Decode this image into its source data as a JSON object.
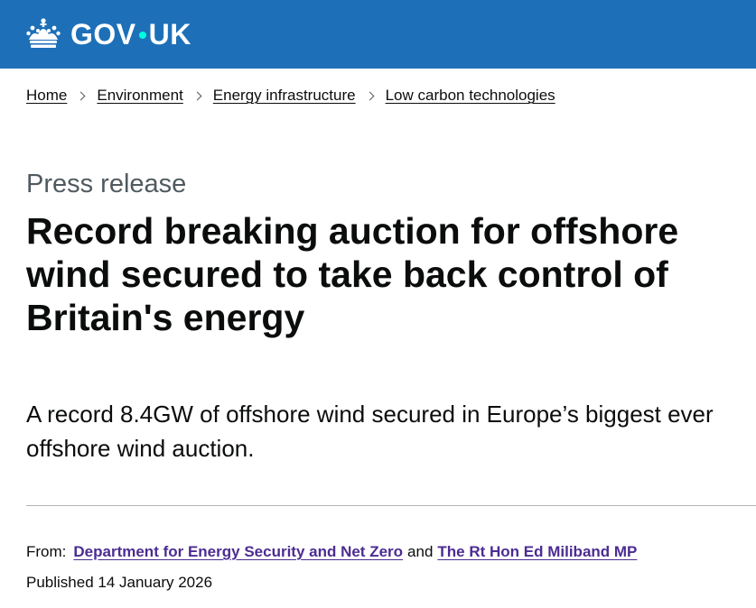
{
  "header": {
    "logo_text_left": "GOV",
    "logo_text_right": "UK"
  },
  "breadcrumbs": [
    {
      "label": "Home"
    },
    {
      "label": "Environment"
    },
    {
      "label": "Energy infrastructure"
    },
    {
      "label": "Low carbon technologies"
    }
  ],
  "article": {
    "caption": "Press release",
    "title": "Record breaking auction for offshore wind secured to take back control of Britain's energy",
    "lead": "A record 8.4GW of offshore wind secured in Europe’s biggest ever offshore wind auction."
  },
  "metadata": {
    "from_label": "From:",
    "org_1": "Department for Energy Security and Net Zero",
    "and_text": "and",
    "org_2": "The Rt Hon Ed Miliband MP",
    "published": "Published 14 January 2026"
  },
  "colors": {
    "header_bg": "#1d70b8",
    "link_visited": "#4c2c92",
    "text": "#0b0c0c",
    "secondary_text": "#505a5f",
    "logo_dot": "#00ffe0"
  }
}
